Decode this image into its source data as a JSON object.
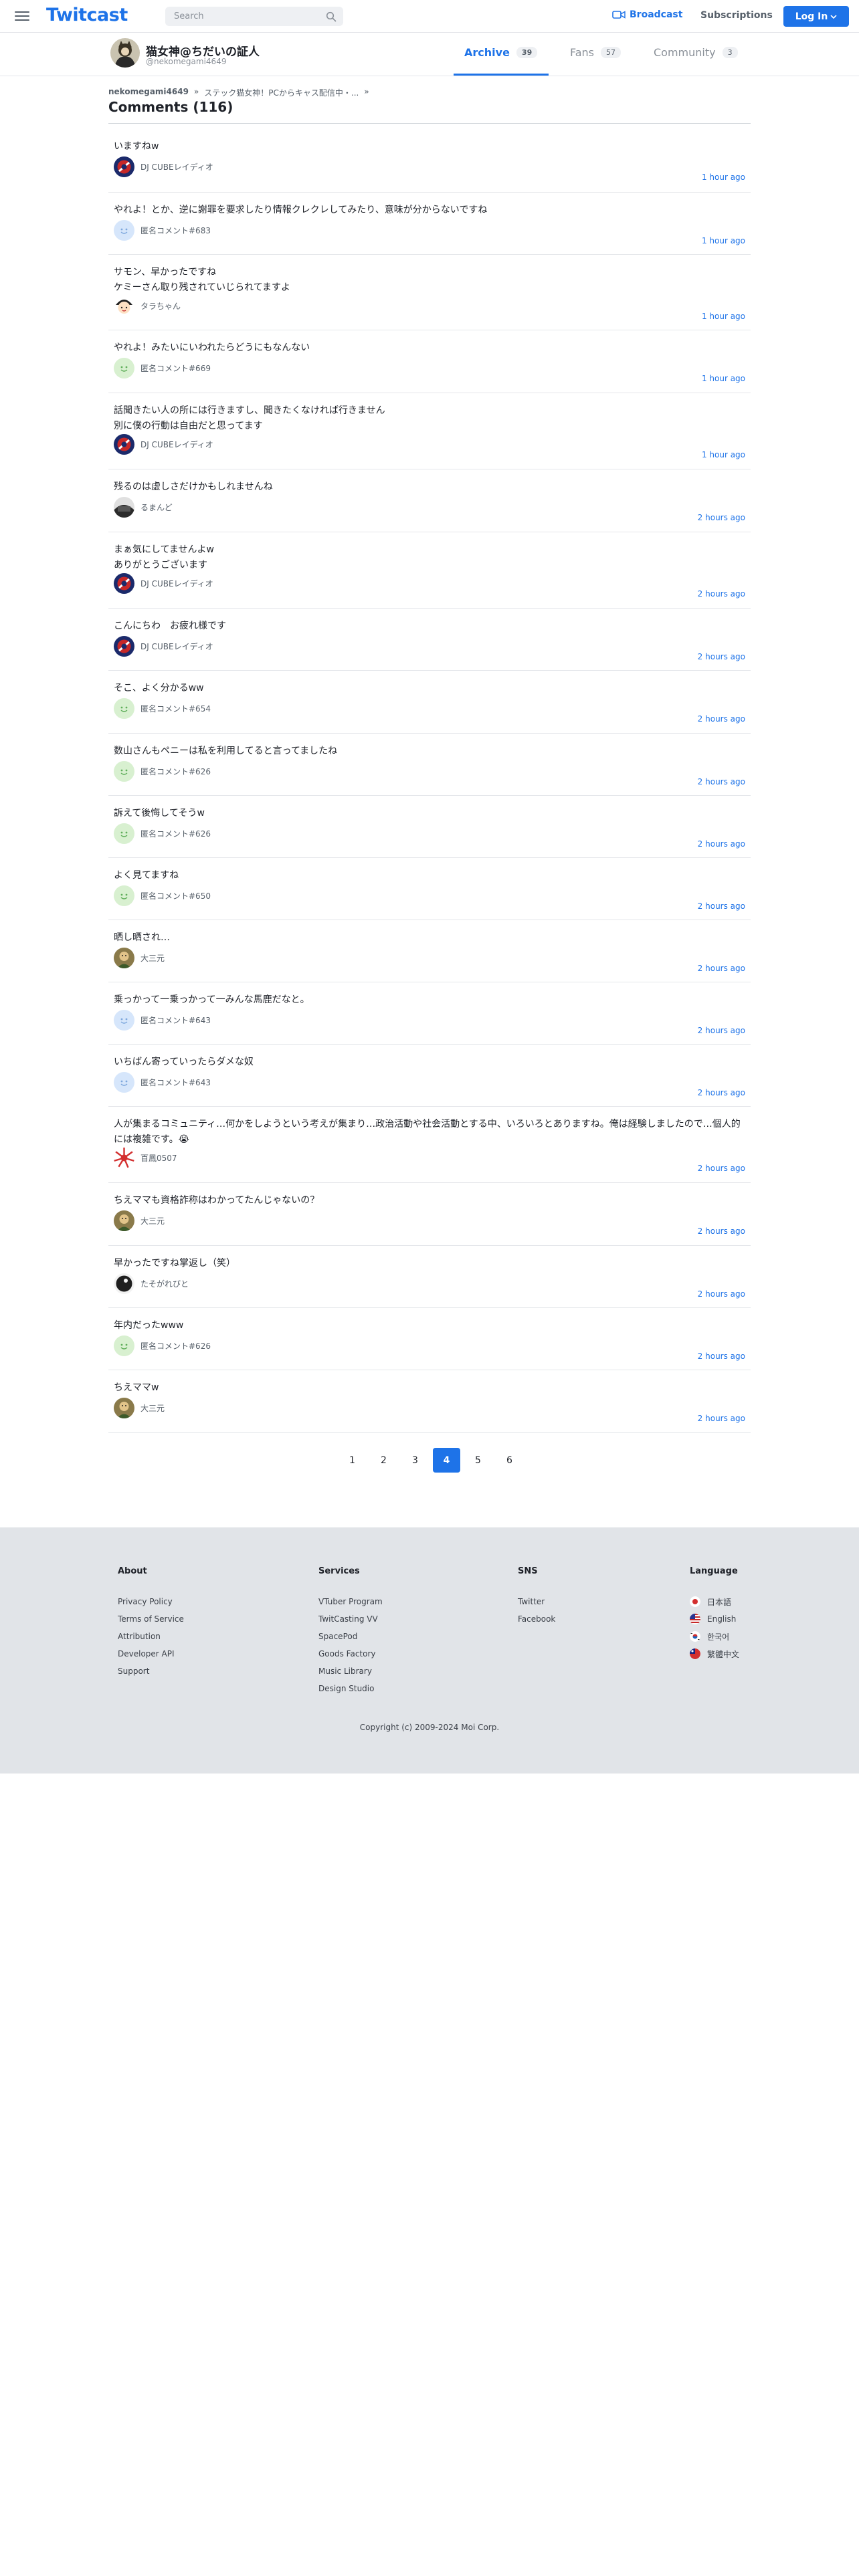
{
  "header": {
    "logo": "Twitcast",
    "search_placeholder": "Search",
    "broadcast": "Broadcast",
    "subscriptions": "Subscriptions",
    "login": "Log In"
  },
  "channel": {
    "name": "猫女神@ちだいの証人",
    "id": "@nekomegami4649",
    "tabs": [
      {
        "label": "Archive",
        "count": "39"
      },
      {
        "label": "Fans",
        "count": "57"
      },
      {
        "label": "Community",
        "count": "3"
      }
    ]
  },
  "breadcrumb": {
    "user": "nekomegami4649",
    "sep": "»",
    "movie": "ステック猫女神！PCからキャス配信中・..."
  },
  "page_title": "Comments (116)",
  "comments": [
    {
      "text": "いますねw",
      "author": "DJ CUBEレイディオ",
      "avatar": "dj-cube-avatar",
      "time": "1 hour ago"
    },
    {
      "text": "やれよ！とか、逆に謝罪を要求したり情報クレクレしてみたり、意味が分からないですね",
      "author": "匿名コメント#683",
      "avatar": "anonymous-avatar",
      "time": "1 hour ago"
    },
    {
      "text": "サモン、早かったですね\nケミーさん取り残されていじられてますよ",
      "author": "タラちゃん",
      "avatar": "tara-avatar",
      "time": "1 hour ago"
    },
    {
      "text": "やれよ！みたいにいわれたらどうにもなんない",
      "author": "匿名コメント#669",
      "avatar": "anonymous-green-avatar",
      "time": "1 hour ago"
    },
    {
      "text": "話聞きたい人の所には行きますし、聞きたくなければ行きません\n別に僕の行動は自由だと思ってます",
      "author": "DJ CUBEレイディオ",
      "avatar": "dj-cube-avatar",
      "time": "1 hour ago"
    },
    {
      "text": "残るのは虚しさだけかもしれませんね",
      "author": "るまんど",
      "avatar": "rumando-avatar",
      "time": "2 hours ago"
    },
    {
      "text": "まぁ気にしてませんよw\nありがとうございます",
      "author": "DJ CUBEレイディオ",
      "avatar": "dj-cube-avatar",
      "time": "2 hours ago"
    },
    {
      "text": "こんにちわ　お疲れ様です",
      "author": "DJ CUBEレイディオ",
      "avatar": "dj-cube-avatar",
      "time": "2 hours ago"
    },
    {
      "text": "そこ、よく分かるww",
      "author": "匿名コメント#654",
      "avatar": "anonymous-green-avatar",
      "time": "2 hours ago"
    },
    {
      "text": "数山さんもペニーは私を利用してると言ってましたね",
      "author": "匿名コメント#626",
      "avatar": "anonymous-green-avatar",
      "time": "2 hours ago"
    },
    {
      "text": "訴えて後悔してそうw",
      "author": "匿名コメント#626",
      "avatar": "anonymous-green-avatar",
      "time": "2 hours ago"
    },
    {
      "text": "よく見てますね",
      "author": "匿名コメント#650",
      "avatar": "anonymous-green-avatar",
      "time": "2 hours ago"
    },
    {
      "text": "晒し晒され…",
      "author": "大三元",
      "avatar": "daisangen-avatar",
      "time": "2 hours ago"
    },
    {
      "text": "乗っかって一乗っかって一みんな馬鹿だなと。",
      "author": "匿名コメント#643",
      "avatar": "anonymous-avatar",
      "time": "2 hours ago"
    },
    {
      "text": "いちばん寄っていったらダメな奴",
      "author": "匿名コメント#643",
      "avatar": "anonymous-avatar",
      "time": "2 hours ago"
    },
    {
      "text": "人が集まるコミュニティ…何かをしようという考えが集まり…政治活動や社会活動とする中、いろいろとありますね。俺は経験しましたので…個人的には複雑です。😭",
      "author": "百鳳0507",
      "avatar": "hyakuhou-avatar",
      "time": "2 hours ago"
    },
    {
      "text": "ちえママも資格詐称はわかってたんじゃないの？",
      "author": "大三元",
      "avatar": "daisangen-avatar",
      "time": "2 hours ago"
    },
    {
      "text": "早かったですね掌返し（笑）",
      "author": "たそがれびと",
      "avatar": "tasogare-avatar",
      "time": "2 hours ago"
    },
    {
      "text": "年内だったwww",
      "author": "匿名コメント#626",
      "avatar": "anonymous-green-avatar",
      "time": "2 hours ago"
    },
    {
      "text": "ちえママw",
      "author": "大三元",
      "avatar": "daisangen-avatar",
      "time": "2 hours ago"
    }
  ],
  "pagination": {
    "pages": [
      "1",
      "2",
      "3",
      "4",
      "5",
      "6"
    ],
    "current": "4"
  },
  "footer": {
    "about": {
      "title": "About",
      "links": [
        "Privacy Policy",
        "Terms of Service",
        "Attribution",
        "Developer API",
        "Support"
      ]
    },
    "services": {
      "title": "Services",
      "links": [
        "VTuber Program",
        "TwitCasting VV",
        "SpacePod",
        "Goods Factory",
        "Music Library",
        "Design Studio"
      ]
    },
    "sns": {
      "title": "SNS",
      "links": [
        "Twitter",
        "Facebook"
      ]
    },
    "language": {
      "title": "Language",
      "links": [
        "日本語",
        "English",
        "한국어",
        "繁體中文"
      ]
    },
    "copyright": "Copyright (c) 2009-2024 Moi Corp."
  },
  "colors": {
    "accent": "#1e73e8",
    "footer_bg": "#e1e4e8"
  }
}
